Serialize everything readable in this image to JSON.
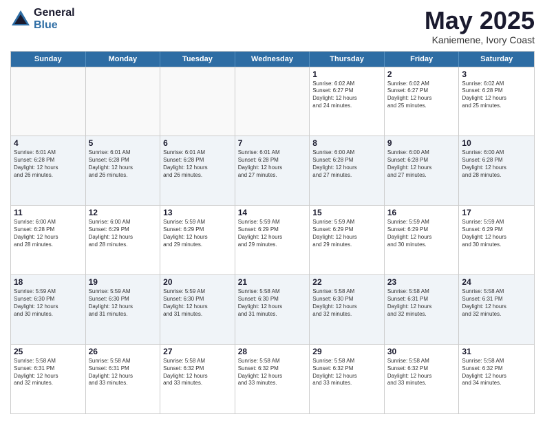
{
  "logo": {
    "general": "General",
    "blue": "Blue"
  },
  "title": "May 2025",
  "location": "Kaniemene, Ivory Coast",
  "days_header": [
    "Sunday",
    "Monday",
    "Tuesday",
    "Wednesday",
    "Thursday",
    "Friday",
    "Saturday"
  ],
  "weeks": [
    [
      {
        "day": "",
        "empty": true
      },
      {
        "day": "",
        "empty": true
      },
      {
        "day": "",
        "empty": true
      },
      {
        "day": "",
        "empty": true
      },
      {
        "day": "1",
        "line1": "Sunrise: 6:02 AM",
        "line2": "Sunset: 6:27 PM",
        "line3": "Daylight: 12 hours",
        "line4": "and 24 minutes."
      },
      {
        "day": "2",
        "line1": "Sunrise: 6:02 AM",
        "line2": "Sunset: 6:27 PM",
        "line3": "Daylight: 12 hours",
        "line4": "and 25 minutes."
      },
      {
        "day": "3",
        "line1": "Sunrise: 6:02 AM",
        "line2": "Sunset: 6:28 PM",
        "line3": "Daylight: 12 hours",
        "line4": "and 25 minutes."
      }
    ],
    [
      {
        "day": "4",
        "line1": "Sunrise: 6:01 AM",
        "line2": "Sunset: 6:28 PM",
        "line3": "Daylight: 12 hours",
        "line4": "and 26 minutes."
      },
      {
        "day": "5",
        "line1": "Sunrise: 6:01 AM",
        "line2": "Sunset: 6:28 PM",
        "line3": "Daylight: 12 hours",
        "line4": "and 26 minutes."
      },
      {
        "day": "6",
        "line1": "Sunrise: 6:01 AM",
        "line2": "Sunset: 6:28 PM",
        "line3": "Daylight: 12 hours",
        "line4": "and 26 minutes."
      },
      {
        "day": "7",
        "line1": "Sunrise: 6:01 AM",
        "line2": "Sunset: 6:28 PM",
        "line3": "Daylight: 12 hours",
        "line4": "and 27 minutes."
      },
      {
        "day": "8",
        "line1": "Sunrise: 6:00 AM",
        "line2": "Sunset: 6:28 PM",
        "line3": "Daylight: 12 hours",
        "line4": "and 27 minutes."
      },
      {
        "day": "9",
        "line1": "Sunrise: 6:00 AM",
        "line2": "Sunset: 6:28 PM",
        "line3": "Daylight: 12 hours",
        "line4": "and 27 minutes."
      },
      {
        "day": "10",
        "line1": "Sunrise: 6:00 AM",
        "line2": "Sunset: 6:28 PM",
        "line3": "Daylight: 12 hours",
        "line4": "and 28 minutes."
      }
    ],
    [
      {
        "day": "11",
        "line1": "Sunrise: 6:00 AM",
        "line2": "Sunset: 6:28 PM",
        "line3": "Daylight: 12 hours",
        "line4": "and 28 minutes."
      },
      {
        "day": "12",
        "line1": "Sunrise: 6:00 AM",
        "line2": "Sunset: 6:29 PM",
        "line3": "Daylight: 12 hours",
        "line4": "and 28 minutes."
      },
      {
        "day": "13",
        "line1": "Sunrise: 5:59 AM",
        "line2": "Sunset: 6:29 PM",
        "line3": "Daylight: 12 hours",
        "line4": "and 29 minutes."
      },
      {
        "day": "14",
        "line1": "Sunrise: 5:59 AM",
        "line2": "Sunset: 6:29 PM",
        "line3": "Daylight: 12 hours",
        "line4": "and 29 minutes."
      },
      {
        "day": "15",
        "line1": "Sunrise: 5:59 AM",
        "line2": "Sunset: 6:29 PM",
        "line3": "Daylight: 12 hours",
        "line4": "and 29 minutes."
      },
      {
        "day": "16",
        "line1": "Sunrise: 5:59 AM",
        "line2": "Sunset: 6:29 PM",
        "line3": "Daylight: 12 hours",
        "line4": "and 30 minutes."
      },
      {
        "day": "17",
        "line1": "Sunrise: 5:59 AM",
        "line2": "Sunset: 6:29 PM",
        "line3": "Daylight: 12 hours",
        "line4": "and 30 minutes."
      }
    ],
    [
      {
        "day": "18",
        "line1": "Sunrise: 5:59 AM",
        "line2": "Sunset: 6:30 PM",
        "line3": "Daylight: 12 hours",
        "line4": "and 30 minutes."
      },
      {
        "day": "19",
        "line1": "Sunrise: 5:59 AM",
        "line2": "Sunset: 6:30 PM",
        "line3": "Daylight: 12 hours",
        "line4": "and 31 minutes."
      },
      {
        "day": "20",
        "line1": "Sunrise: 5:59 AM",
        "line2": "Sunset: 6:30 PM",
        "line3": "Daylight: 12 hours",
        "line4": "and 31 minutes."
      },
      {
        "day": "21",
        "line1": "Sunrise: 5:58 AM",
        "line2": "Sunset: 6:30 PM",
        "line3": "Daylight: 12 hours",
        "line4": "and 31 minutes."
      },
      {
        "day": "22",
        "line1": "Sunrise: 5:58 AM",
        "line2": "Sunset: 6:30 PM",
        "line3": "Daylight: 12 hours",
        "line4": "and 32 minutes."
      },
      {
        "day": "23",
        "line1": "Sunrise: 5:58 AM",
        "line2": "Sunset: 6:31 PM",
        "line3": "Daylight: 12 hours",
        "line4": "and 32 minutes."
      },
      {
        "day": "24",
        "line1": "Sunrise: 5:58 AM",
        "line2": "Sunset: 6:31 PM",
        "line3": "Daylight: 12 hours",
        "line4": "and 32 minutes."
      }
    ],
    [
      {
        "day": "25",
        "line1": "Sunrise: 5:58 AM",
        "line2": "Sunset: 6:31 PM",
        "line3": "Daylight: 12 hours",
        "line4": "and 32 minutes."
      },
      {
        "day": "26",
        "line1": "Sunrise: 5:58 AM",
        "line2": "Sunset: 6:31 PM",
        "line3": "Daylight: 12 hours",
        "line4": "and 33 minutes."
      },
      {
        "day": "27",
        "line1": "Sunrise: 5:58 AM",
        "line2": "Sunset: 6:32 PM",
        "line3": "Daylight: 12 hours",
        "line4": "and 33 minutes."
      },
      {
        "day": "28",
        "line1": "Sunrise: 5:58 AM",
        "line2": "Sunset: 6:32 PM",
        "line3": "Daylight: 12 hours",
        "line4": "and 33 minutes."
      },
      {
        "day": "29",
        "line1": "Sunrise: 5:58 AM",
        "line2": "Sunset: 6:32 PM",
        "line3": "Daylight: 12 hours",
        "line4": "and 33 minutes."
      },
      {
        "day": "30",
        "line1": "Sunrise: 5:58 AM",
        "line2": "Sunset: 6:32 PM",
        "line3": "Daylight: 12 hours",
        "line4": "and 33 minutes."
      },
      {
        "day": "31",
        "line1": "Sunrise: 5:58 AM",
        "line2": "Sunset: 6:32 PM",
        "line3": "Daylight: 12 hours",
        "line4": "and 34 minutes."
      }
    ]
  ]
}
